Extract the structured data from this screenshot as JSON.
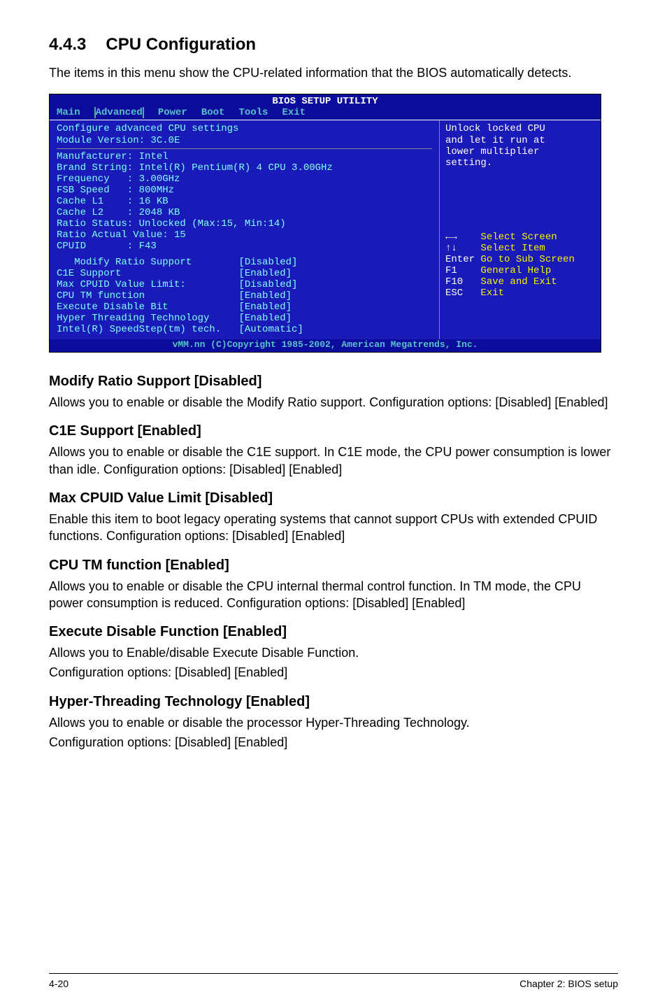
{
  "section": {
    "number": "4.4.3",
    "title": "CPU Configuration"
  },
  "intro": "The items in this menu show the CPU-related information that the BIOS automatically detects.",
  "bios": {
    "title": "BIOS SETUP UTILITY",
    "tabs": [
      "Main",
      "Advanced",
      "Power",
      "Boot",
      "Tools",
      "Exit"
    ],
    "left": {
      "header1": "Configure advanced CPU settings",
      "header2": "Module Version: 3C.0E",
      "info": [
        "Manufacturer: Intel",
        "Brand String: Intel(R) Pentium(R) 4 CPU 3.00GHz",
        "Frequency   : 3.00GHz",
        "FSB Speed   : 800MHz",
        "Cache L1    : 16 KB",
        "Cache L2    : 2048 KB",
        "Ratio Status: Unlocked (Max:15, Min:14)",
        "Ratio Actual Value: 15",
        "CPUID       : F43"
      ],
      "settings": [
        {
          "label": "   Modify Ratio Support",
          "value": "[Disabled]"
        },
        {
          "label": "C1E Support",
          "value": "[Enabled]"
        },
        {
          "label": "Max CPUID Value Limit:",
          "value": "[Disabled]"
        },
        {
          "label": "CPU TM function",
          "value": "[Enabled]"
        },
        {
          "label": "Execute Disable Bit",
          "value": "[Enabled]"
        },
        {
          "label": "Hyper Threading Technology",
          "value": "[Enabled]"
        },
        {
          "label": "Intel(R) SpeedStep(tm) tech.",
          "value": "[Automatic]"
        }
      ]
    },
    "right": {
      "help": [
        "Unlock locked CPU",
        "and let it run at",
        "lower multiplier",
        "setting."
      ],
      "keys": [
        {
          "k": "←→",
          "d": "Select Screen"
        },
        {
          "k": "↑↓",
          "d": "Select Item"
        },
        {
          "k": "Enter",
          "d": "Go to Sub Screen"
        },
        {
          "k": "F1",
          "d": "General Help"
        },
        {
          "k": "F10",
          "d": "Save and Exit"
        },
        {
          "k": "ESC",
          "d": "Exit"
        }
      ]
    },
    "footer": "vMM.nn (C)Copyright 1985-2002, American Megatrends, Inc."
  },
  "options": [
    {
      "h": "Modify Ratio Support [Disabled]",
      "p": [
        "Allows you to enable or disable the Modify Ratio support. Configuration options: [Disabled] [Enabled]"
      ]
    },
    {
      "h": "C1E Support [Enabled]",
      "p": [
        "Allows you to enable or disable the C1E support. In C1E mode, the CPU power consumption is lower than idle. Configuration options: [Disabled] [Enabled]"
      ]
    },
    {
      "h": "Max CPUID Value Limit [Disabled]",
      "p": [
        "Enable this item to boot legacy operating systems that cannot support CPUs with extended CPUID functions. Configuration options: [Disabled] [Enabled]"
      ]
    },
    {
      "h": "CPU TM function [Enabled]",
      "p": [
        "Allows you to enable or disable the CPU internal thermal control function. In TM mode, the CPU power consumption is reduced. Configuration options: [Disabled] [Enabled]"
      ]
    },
    {
      "h": "Execute Disable Function [Enabled]",
      "p": [
        "Allows you to Enable/disable Execute Disable Function.",
        "Configuration options: [Disabled] [Enabled]"
      ]
    },
    {
      "h": "Hyper-Threading Technology [Enabled]",
      "p": [
        "Allows you to enable or disable the processor Hyper-Threading Technology.",
        "Configuration options: [Disabled] [Enabled]"
      ]
    }
  ],
  "page_footer": {
    "left": "4-20",
    "right": "Chapter 2: BIOS setup"
  }
}
